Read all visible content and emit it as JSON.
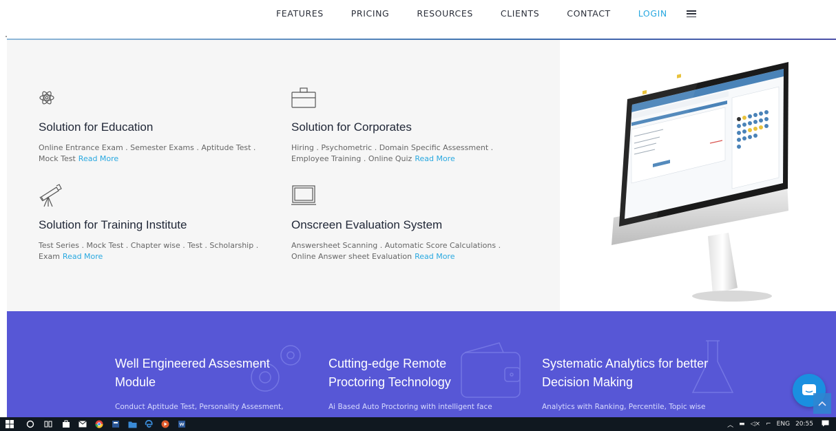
{
  "nav": {
    "links": [
      "FEATURES",
      "PRICING",
      "RESOURCES",
      "CLIENTS",
      "CONTACT"
    ],
    "login": "LOGIN"
  },
  "solutions": [
    {
      "icon": "atom-icon",
      "title": "Solution for Education",
      "desc": "Online Entrance Exam . Semester Exams . Aptitude Test . Mock Test",
      "link": "Read More"
    },
    {
      "icon": "briefcase-icon",
      "title": "Solution for Corporates",
      "desc": "Hiring . Psychometric . Domain Specific Assessment . Employee Training . Online Quiz",
      "link": "Read More"
    },
    {
      "icon": "telescope-icon",
      "title": "Solution for Training Institute",
      "desc": "Test Series . Mock Test . Chapter wise . Test . Scholarship . Exam",
      "link": "Read More"
    },
    {
      "icon": "laptop-icon",
      "title": "Onscreen Evaluation System",
      "desc": "Answersheet Scanning . Automatic Score Calculations . Online Answer sheet Evaluation",
      "link": "Read More"
    }
  ],
  "features": [
    {
      "icon": "gears-icon",
      "title_line1": "Well Engineered Assesment",
      "title_line2": "Module",
      "desc": "Conduct Aptitude Test, Personality Assesment,"
    },
    {
      "icon": "wallet-icon",
      "title_line1": "Cutting-edge Remote",
      "title_line2": "Proctoring Technology",
      "desc": "Ai Based Auto Proctoring with intelligent face"
    },
    {
      "icon": "flask-icon",
      "title_line1": "Systematic Analytics for better",
      "title_line2": "Decision Making",
      "desc": "Analytics with Ranking, Percentile, Topic wise"
    }
  ],
  "taskbar": {
    "lang": "ENG",
    "time": "20:55"
  },
  "colors": {
    "accent": "#28a8e0",
    "band": "#5757d6",
    "chat": "#1a8fe0"
  }
}
